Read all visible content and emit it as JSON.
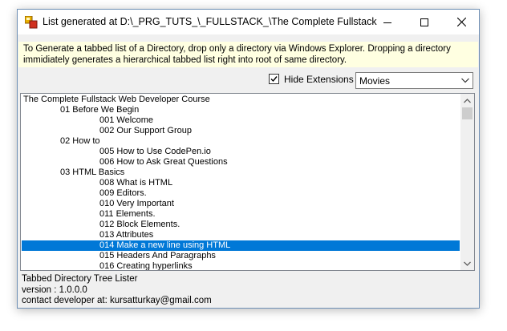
{
  "window": {
    "title": "List generated at D:\\_PRG_TUTS_\\_FULLSTACK_\\The Complete Fullstack We...",
    "minimize_label": "minimize",
    "maximize_label": "maximize",
    "close_label": "close"
  },
  "info_text": "To Generate a tabbed list of a Directory, drop only a directory via Windows Explorer. Dropping a directory immidiately generates a hierarchical tabbed list right into root of same directory.",
  "options": {
    "hide_extensions_label": "Hide Extensions",
    "hide_extensions_checked": true,
    "combo_value": "Movies"
  },
  "tree": [
    {
      "text": "The Complete Fullstack Web Developer Course",
      "level": 0,
      "selected": false
    },
    {
      "text": "01 Before We Begin",
      "level": 1,
      "selected": false
    },
    {
      "text": "001 Welcome",
      "level": 2,
      "selected": false
    },
    {
      "text": "002 Our Support Group",
      "level": 2,
      "selected": false
    },
    {
      "text": "02 How to",
      "level": 1,
      "selected": false
    },
    {
      "text": "005 How to Use CodePen.io",
      "level": 2,
      "selected": false
    },
    {
      "text": "006 How to Ask Great Questions",
      "level": 2,
      "selected": false
    },
    {
      "text": "03 HTML Basics",
      "level": 1,
      "selected": false
    },
    {
      "text": "008 What is HTML",
      "level": 2,
      "selected": false
    },
    {
      "text": "009 Editors.",
      "level": 2,
      "selected": false
    },
    {
      "text": "010 Very Important",
      "level": 2,
      "selected": false
    },
    {
      "text": "011 Elements.",
      "level": 2,
      "selected": false
    },
    {
      "text": "012 Block Elements.",
      "level": 2,
      "selected": false
    },
    {
      "text": "013 Attributes",
      "level": 2,
      "selected": false
    },
    {
      "text": "014 Make a new line using HTML",
      "level": 2,
      "selected": true
    },
    {
      "text": "015 Headers And Paragraphs",
      "level": 2,
      "selected": false
    },
    {
      "text": "016 Creating hyperlinks",
      "level": 2,
      "selected": false
    }
  ],
  "footer": {
    "app_name": "Tabbed Directory Tree Lister",
    "version": "version : 1.0.0.0",
    "contact": "contact developer at: kursatturkay@gmail.com"
  },
  "colors": {
    "selection": "#0078d7",
    "info_background": "#ffffe1",
    "window_background": "#f0f0f0"
  }
}
